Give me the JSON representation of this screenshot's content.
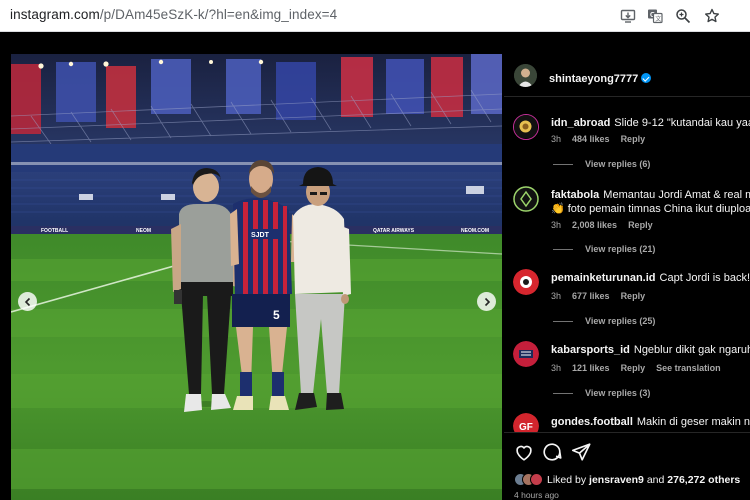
{
  "browser": {
    "url_host": "instagram.com",
    "url_path": "/p/DAm45eSzK-k/?hl=en&img_index=4",
    "icons": [
      "install-app-icon",
      "translate-icon",
      "zoom-icon",
      "bookmark-star-icon"
    ]
  },
  "post": {
    "author": "shintaeyong7777",
    "verified": true
  },
  "comments": [
    {
      "user": "idn_abroad",
      "text": "Slide 9-12 \"kutandai kau yaa\"",
      "time": "3h",
      "likes": "484 likes",
      "reply": "Reply",
      "view_replies": "View replies (6)"
    },
    {
      "user": "faktabola",
      "text": "Memantau Jordi Amat & real mem",
      "text2": "👏 foto pemain timnas China ikut diupload 😂",
      "time": "3h",
      "likes": "2,008 likes",
      "reply": "Reply",
      "view_replies": "View replies (21)"
    },
    {
      "user": "pemainketurunan.id",
      "text": "Capt Jordi is back! 😍",
      "time": "3h",
      "likes": "677 likes",
      "reply": "Reply",
      "view_replies": "View replies (25)"
    },
    {
      "user": "kabarsports_id",
      "text": "Ngeblur dikit gak ngaruh 😎",
      "time": "3h",
      "likes": "121 likes",
      "reply": "Reply",
      "translation": "See translation",
      "view_replies": "View replies (3)"
    },
    {
      "user": "gondes.football",
      "text": "Makin di geser makin ngera"
    }
  ],
  "footer": {
    "liked_by_prefix": "Liked by",
    "liked_by_user": "jensraven9",
    "liked_by_and": "and",
    "liked_by_others": "276,272 others",
    "posted_ago": "4 hours ago"
  },
  "photo": {
    "boards": [
      "FOOTBALL",
      "NEOM",
      "QATAR AIRWAYS",
      "NEOM.COM"
    ],
    "jersey_sponsor": "SJDT"
  }
}
